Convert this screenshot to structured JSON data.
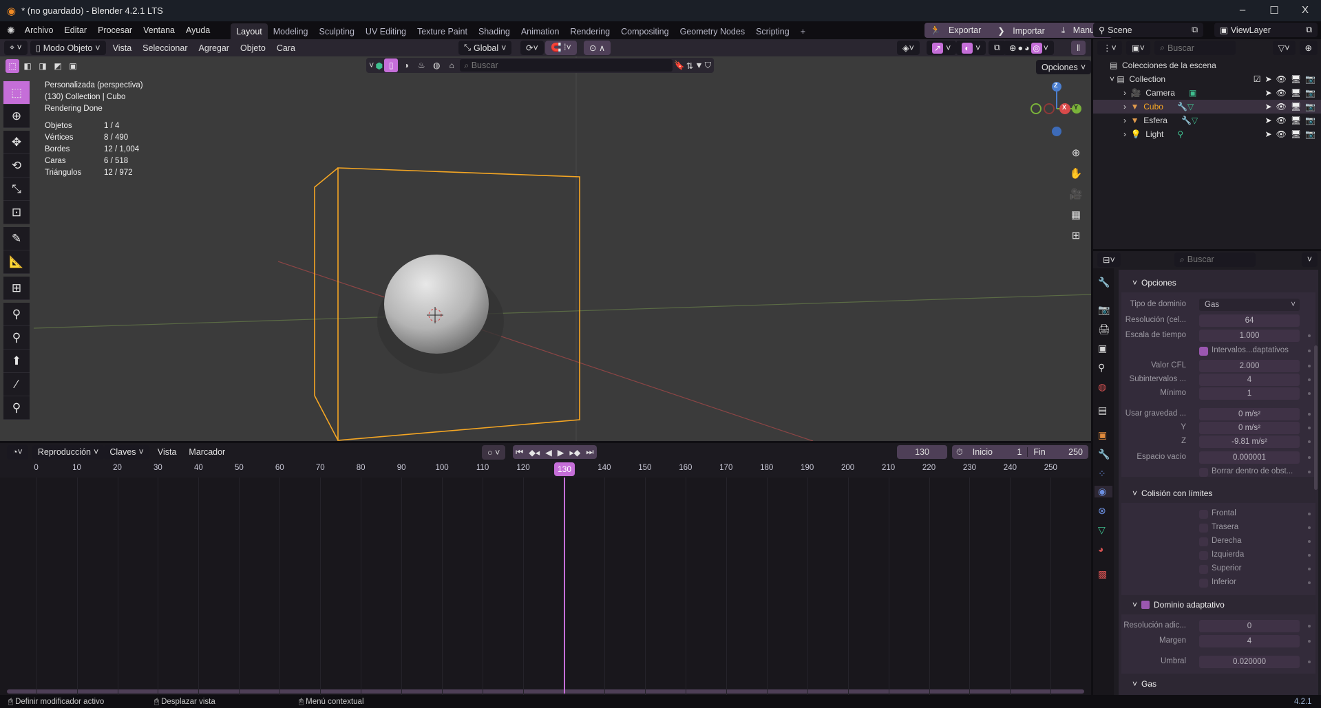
{
  "window": {
    "title": "* (no guardado) - Blender 4.2.1 LTS",
    "minimize": "–",
    "maximize": "☐",
    "close": "X"
  },
  "menubar": {
    "items": [
      "Archivo",
      "Editar",
      "Procesar",
      "Ventana",
      "Ayuda"
    ],
    "workspaces": [
      "Layout",
      "Modeling",
      "Sculpting",
      "UV Editing",
      "Texture Paint",
      "Shading",
      "Animation",
      "Rendering",
      "Compositing",
      "Geometry Nodes",
      "Scripting",
      "+"
    ],
    "active_workspace": "Layout",
    "addons": [
      "Exportar",
      "Importar",
      "Manual"
    ],
    "scene": "Scene",
    "view_layer": "ViewLayer"
  },
  "viewport_header": {
    "mode": "Modo Objeto",
    "menus": [
      "Vista",
      "Seleccionar",
      "Agregar",
      "Objeto",
      "Cara"
    ],
    "orientation": "Global",
    "search_placeholder": "Buscar",
    "options": "Opciones"
  },
  "viewport": {
    "view_name": "Personalizada (perspectiva)",
    "context": "(130) Collection | Cubo",
    "render_status": "Rendering Done",
    "stats": [
      {
        "label": "Objetos",
        "value": "1 / 4"
      },
      {
        "label": "Vértices",
        "value": "8 / 490"
      },
      {
        "label": "Bordes",
        "value": "12 / 1,004"
      },
      {
        "label": "Caras",
        "value": "6 / 518"
      },
      {
        "label": "Triángulos",
        "value": "12 / 972"
      }
    ],
    "gizmo": {
      "x": "X",
      "y": "Y",
      "z": "Z"
    },
    "selection_color": "#f5a623"
  },
  "timeline": {
    "menus": [
      "Reproducción",
      "Claves",
      "Vista",
      "Marcador"
    ],
    "current_frame": "130",
    "start_label": "Inicio",
    "start": "1",
    "end_label": "Fin",
    "end": "250",
    "ticks": [
      "0",
      "10",
      "20",
      "30",
      "40",
      "50",
      "60",
      "70",
      "80",
      "90",
      "100",
      "110",
      "120",
      "130",
      "140",
      "150",
      "160",
      "170",
      "180",
      "190",
      "200",
      "210",
      "220",
      "230",
      "240",
      "250"
    ]
  },
  "outliner": {
    "search_placeholder": "Buscar",
    "root": "Colecciones de la escena",
    "collection": "Collection",
    "items": [
      {
        "name": "Camera",
        "color": "#e09a4c"
      },
      {
        "name": "Cubo",
        "color": "#f5a623",
        "selected": true
      },
      {
        "name": "Esfera",
        "color": "#e09a4c"
      },
      {
        "name": "Light",
        "color": "#e09a4c"
      }
    ]
  },
  "properties": {
    "search_placeholder": "Buscar",
    "opciones": {
      "title": "Opciones",
      "domain_type_label": "Tipo de dominio",
      "domain_type": "Gas",
      "resolution_label": "Resolución (cel...",
      "resolution": "64",
      "time_scale_label": "Escala de tiempo",
      "time_scale": "1.000",
      "adaptive_label": "Intervalos...daptativos",
      "cfl_label": "Valor CFL",
      "cfl": "2.000",
      "substeps_label": "Subintervalos ...",
      "substeps": "4",
      "min_label": "Mínimo",
      "min": "1",
      "gravity_label": "Usar gravedad ...",
      "gx": "0 m/s²",
      "y_label": "Y",
      "gy": "0 m/s²",
      "z_label": "Z",
      "gz": "-9.81 m/s²",
      "empty_label": "Espacio vacío",
      "empty": "0.000001",
      "delete_label": "Borrar dentro de obst..."
    },
    "collision": {
      "title": "Colisión con límites",
      "items": [
        "Frontal",
        "Trasera",
        "Derecha",
        "Izquierda",
        "Superior",
        "Inferior"
      ]
    },
    "adaptive": {
      "title": "Dominio adaptativo",
      "add_res_label": "Resolución adic...",
      "add_res": "0",
      "margin_label": "Margen",
      "margin": "4",
      "threshold_label": "Umbral",
      "threshold": "0.020000"
    },
    "gas": {
      "title": "Gas"
    }
  },
  "statusbar": {
    "hints": [
      "Definir modificador activo",
      "Desplazar vista",
      "Menú contextual"
    ],
    "version": "4.2.1"
  }
}
